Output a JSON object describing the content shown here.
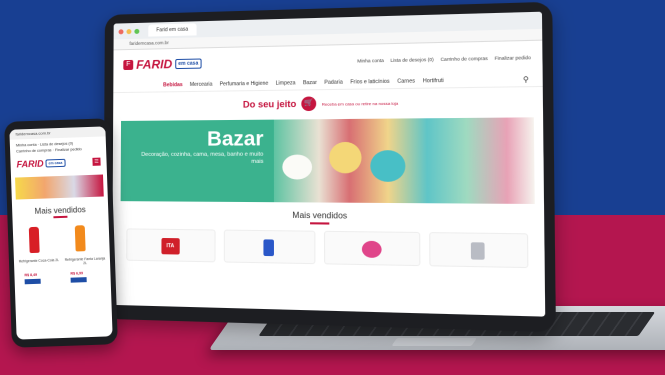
{
  "laptop": {
    "tab_label": "Farid em casa",
    "url": "faridemcasa.com.br",
    "brand": "FARID",
    "brand_tag": "em casa",
    "top_links": [
      "Minha conta",
      "Lista de desejos (0)",
      "Carrinho de compras",
      "Finalizar pedido"
    ],
    "nav": [
      "Bebidas",
      "Mercearia",
      "Perfumaria e Higiene",
      "Limpeza",
      "Bazar",
      "Padaria",
      "Frios e laticínios",
      "Carnes",
      "Hortifruti"
    ],
    "promo_title": "Do seu jeito",
    "promo_sub": "Receba em casa ou retire na nossa loja",
    "banner_title": "Bazar",
    "banner_sub": "Decoração, cozinha, cama, mesa, banho e muito mais",
    "section_title": "Mais vendidos",
    "product_badge": "ITA"
  },
  "phone": {
    "url": "faridemcasa.com.br",
    "links": [
      "Minha conta",
      "Lista de desejos (0)",
      "Carrinho de compras",
      "Finalizar pedido"
    ],
    "brand": "FARID",
    "brand_tag": "em casa",
    "section_title": "Mais vendidos",
    "products": [
      {
        "name": "Refrigerante Coca-Cola 2L",
        "price": "R$ 8,49"
      },
      {
        "name": "Refrigerante Fanta Laranja 2L",
        "price": "R$ 6,99"
      }
    ]
  },
  "colors": {
    "brand_red": "#c5153f",
    "brand_blue": "#1e4ea6",
    "bg_blue": "#183f92",
    "bg_magenta": "#b4164f",
    "banner_green": "#3bb28e"
  }
}
